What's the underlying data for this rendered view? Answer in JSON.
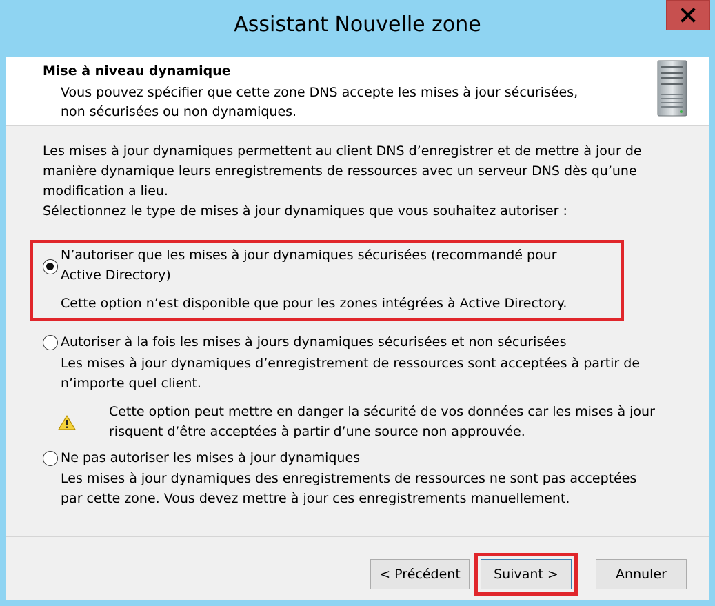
{
  "window": {
    "title": "Assistant Nouvelle zone",
    "close_label": "X"
  },
  "header": {
    "title": "Mise à niveau dynamique",
    "description_line1": "Vous pouvez spécifier que cette zone DNS accepte les mises à jour sécurisées,",
    "description_line2": "non sécurisées ou non dynamiques.",
    "icon": "server-icon"
  },
  "intro": {
    "paragraph": "Les mises à jour dynamiques permettent au client DNS d’enregistrer et de mettre à jour de manière dynamique leurs enregistrements de ressources avec un serveur DNS dès qu’une modification a lieu.",
    "prompt": "Sélectionnez le type de mises à jour dynamiques que vous souhaitez autoriser :"
  },
  "options": [
    {
      "label_line1": "N’autoriser que les mises à jour dynamiques sécurisées (recommandé pour",
      "label_line2": "Active Directory)",
      "description": "Cette option n’est disponible que pour les zones intégrées à Active Directory.",
      "checked": true,
      "highlighted": true
    },
    {
      "label_line1": "Autoriser à la fois les mises à jours dynamiques sécurisées et non sécurisées",
      "description_line1": "Les mises à jour dynamiques d’enregistrement de ressources sont acceptées à partir de",
      "description_line2": "n’importe quel client.",
      "warning_line1": "Cette option peut mettre en danger la sécurité de vos données car les mises à jour",
      "warning_line2": "risquent d’être acceptées à partir d’une source non approuvée.",
      "warning_icon": "warning-icon",
      "checked": false
    },
    {
      "label_line1": "Ne pas autoriser les mises à jour dynamiques",
      "description_line1": "Les mises à jour dynamiques des enregistrements de ressources ne sont pas acceptées",
      "description_line2": "par cette zone. Vous devez mettre à jour ces enregistrements manuellement.",
      "checked": false
    }
  ],
  "buttons": {
    "previous": "< Précédent",
    "next": "Suivant >",
    "cancel": "Annuler"
  },
  "colors": {
    "titlebar": "#8fd4f2",
    "close_button": "#c7504f",
    "highlight": "#e0262b"
  }
}
